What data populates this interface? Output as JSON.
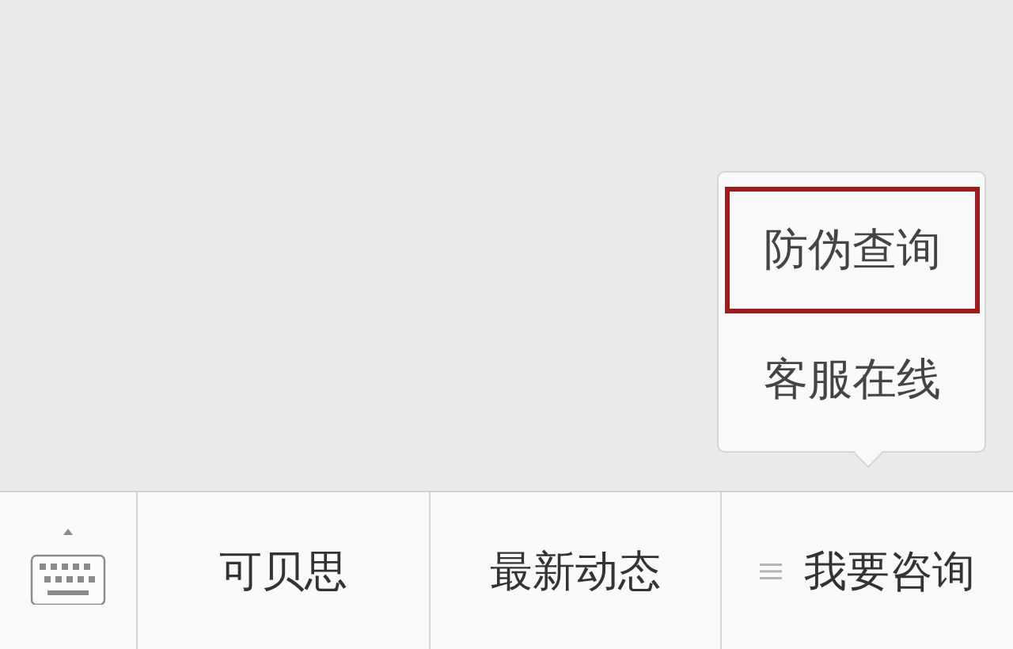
{
  "menu_bar": {
    "items": [
      {
        "label": "可贝思",
        "has_submenu": false
      },
      {
        "label": "最新动态",
        "has_submenu": false
      },
      {
        "label": "我要咨询",
        "has_submenu": true
      }
    ]
  },
  "popup_menu": {
    "items": [
      {
        "label": "防伪查询",
        "selected": true
      },
      {
        "label": "客服在线",
        "selected": false
      }
    ]
  }
}
